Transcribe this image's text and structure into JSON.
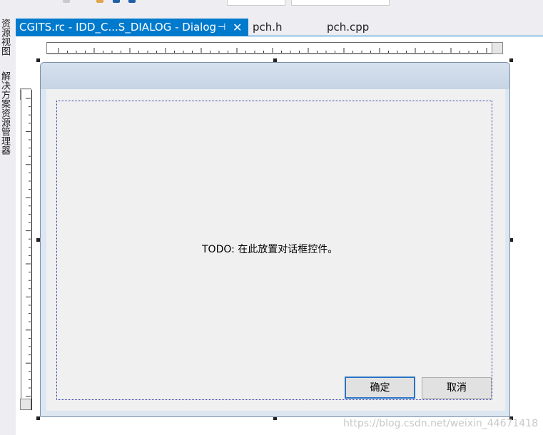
{
  "tabs": [
    {
      "label": "CGITS.rc - IDD_C...S_DIALOG - Dialog",
      "active": true
    },
    {
      "label": "pch.h",
      "active": false
    },
    {
      "label": "pch.cpp",
      "active": false
    }
  ],
  "icons": {
    "pin": "pin-icon",
    "close": "close-icon"
  },
  "left_rail": {
    "item1": "资源视图",
    "item2": "解决方案资源管理器"
  },
  "dialog": {
    "todo_text": "TODO: 在此放置对话框控件。",
    "ok_label": "确定",
    "cancel_label": "取消"
  },
  "watermark": "https://blog.csdn.net/weixin_44671418",
  "colors": {
    "accent": "#007acc",
    "dialog_frame": "#c6d4e4",
    "guide": "#2b3aa8"
  }
}
